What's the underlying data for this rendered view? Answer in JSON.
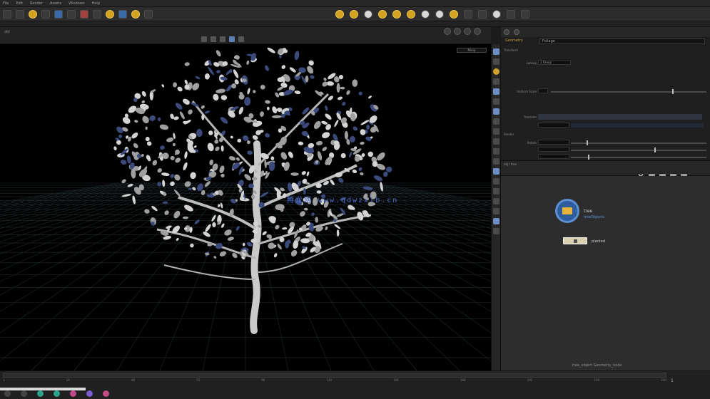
{
  "menubar": {
    "items": [
      "File",
      "Edit",
      "Render",
      "Assets",
      "Windows",
      "Help"
    ]
  },
  "viewport": {
    "path_label": "obj",
    "camera_button": "Persp",
    "watermark": "腾龙网 www.qdwzxlb.cn"
  },
  "params": {
    "node_type": "Geometry",
    "node_name": "Foliage",
    "sections": [
      "Transform",
      "Render"
    ],
    "rows": [
      {
        "label": "Lookup",
        "value": "1 Group"
      },
      {
        "label": "Uniform Scale",
        "value": ""
      },
      {
        "label": "Translate",
        "value": ""
      },
      {
        "label": "Rotate",
        "value": ""
      }
    ]
  },
  "network": {
    "path": "obj / tree",
    "node1": {
      "name": "tree",
      "sub": "treeObjects"
    },
    "node2": {
      "name": "planted"
    },
    "footer": "tree_object  Geometry_node"
  },
  "timeline": {
    "ticks": [
      "1",
      "24",
      "48",
      "72",
      "96",
      "120",
      "144",
      "168",
      "192",
      "216",
      "240"
    ],
    "frame": "1"
  },
  "colors": {
    "accent_blue": "#5b8fd2",
    "accent_yellow": "#e4b43d",
    "watermark": "#4f6fd0"
  }
}
